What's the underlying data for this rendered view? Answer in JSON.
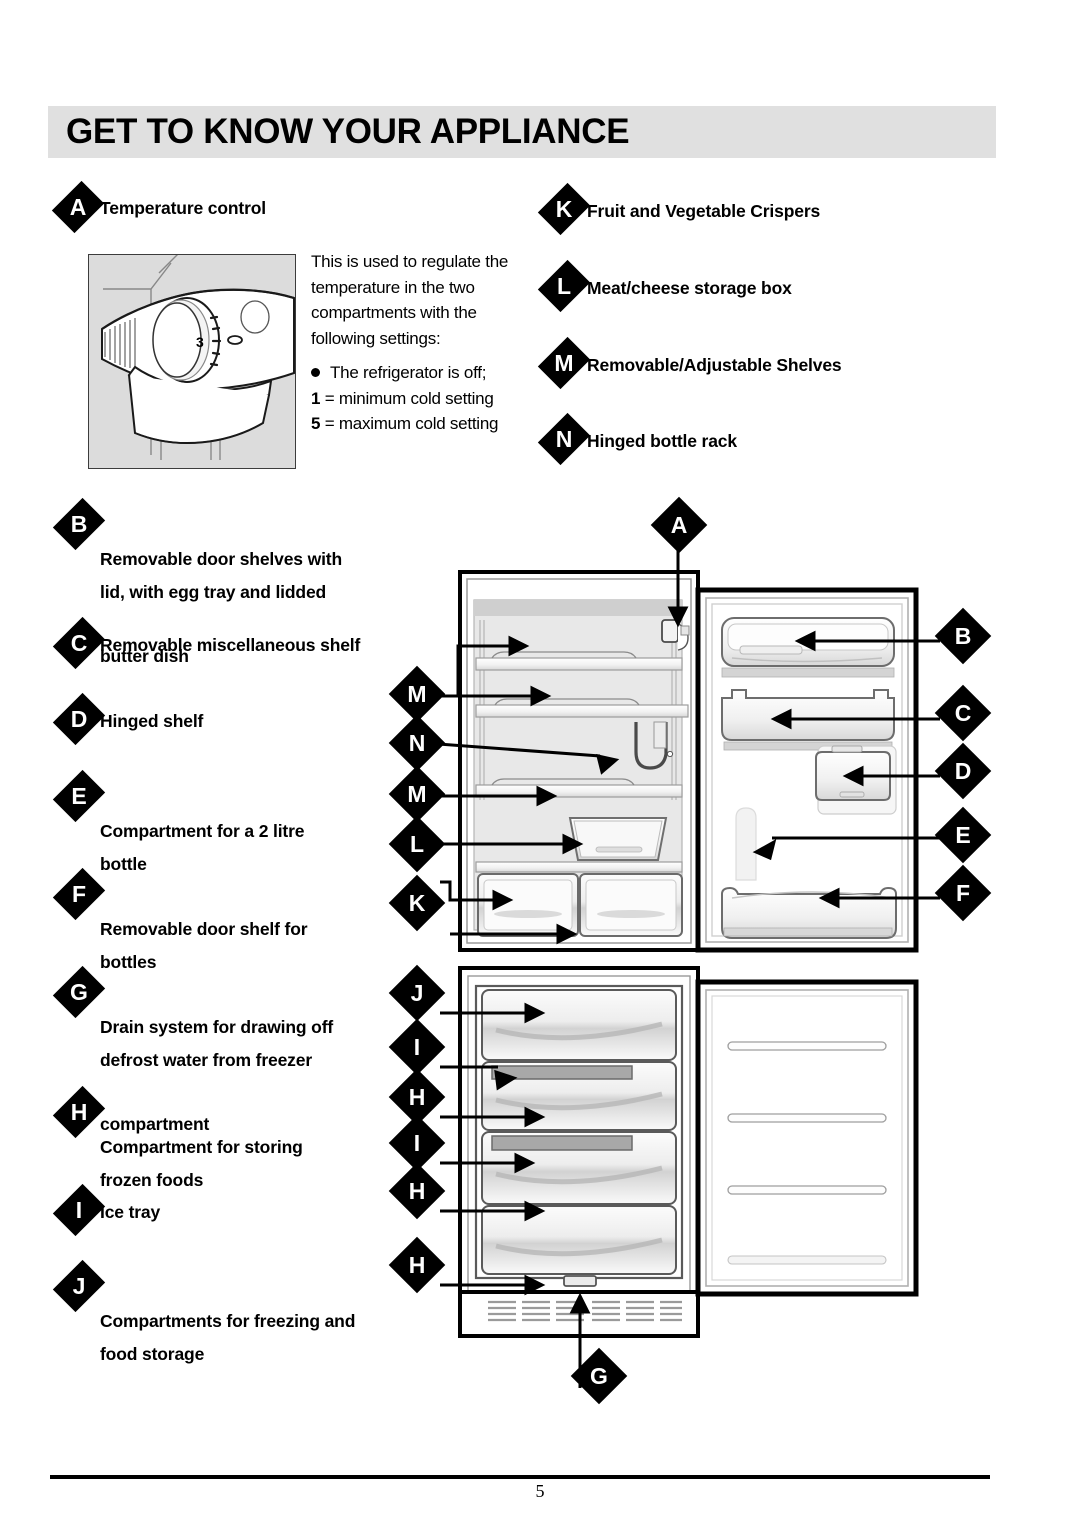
{
  "page": {
    "title": "GET TO KNOW YOUR APPLIANCE",
    "number": "5"
  },
  "temperature_control": {
    "marker": "A",
    "label": "Temperature control",
    "description": "This is used to regulate the temperature in the two compartments with the following settings:",
    "settings": [
      {
        "symbol": "●",
        "text": "The refrigerator is off;"
      },
      {
        "symbol": "1",
        "text": "= minimum cold setting"
      },
      {
        "symbol": "5",
        "text": "= maximum cold setting"
      }
    ],
    "dial_value": "3"
  },
  "legend_left": [
    {
      "marker": "B",
      "line1": "Removable door shelves with",
      "line2": "lid, with egg tray and lidded",
      "line3": "butter dish"
    },
    {
      "marker": "C",
      "line1": "Removable miscellaneous shelf",
      "line2": "",
      "line3": ""
    },
    {
      "marker": "D",
      "line1": "Hinged shelf",
      "line2": "",
      "line3": ""
    },
    {
      "marker": "E",
      "line1": "Compartment for a 2 litre",
      "line2": "bottle",
      "line3": ""
    },
    {
      "marker": "F",
      "line1": "Removable door shelf for",
      "line2": "bottles",
      "line3": ""
    },
    {
      "marker": "G",
      "line1": "Drain system for drawing off",
      "line2": "defrost water from freezer",
      "line3": "compartment"
    },
    {
      "marker": "H",
      "line1": "Compartment for storing",
      "line2": "frozen foods",
      "line3": ""
    },
    {
      "marker": "I",
      "line1": "Ice tray",
      "line2": "",
      "line3": ""
    },
    {
      "marker": "J",
      "line1": "Compartments for freezing and",
      "line2": "food storage",
      "line3": ""
    }
  ],
  "legend_right": [
    {
      "marker": "K",
      "label": "Fruit and Vegetable Crispers"
    },
    {
      "marker": "L",
      "label": "Meat/cheese storage box"
    },
    {
      "marker": "M",
      "label": "Removable/Adjustable Shelves"
    },
    {
      "marker": "N",
      "label": "Hinged bottle rack"
    }
  ],
  "diagram_callouts": {
    "top": "A",
    "right": [
      "B",
      "C",
      "D",
      "E",
      "F"
    ],
    "left_fridge": [
      "M",
      "N",
      "M",
      "L",
      "K"
    ],
    "left_freezer": [
      "J",
      "I",
      "H",
      "I",
      "H",
      "H"
    ],
    "bottom": "G"
  },
  "colors": {
    "header_band": "#e0e0e0",
    "illustration_bg": "#dcdcdc",
    "marker_fill": "#000000",
    "marker_text": "#ffffff"
  }
}
